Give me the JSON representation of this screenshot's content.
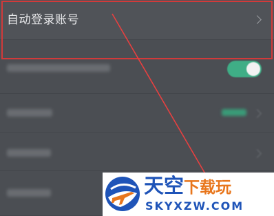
{
  "settings": {
    "rows": [
      {
        "label": "自动登录账号",
        "type": "link"
      }
    ]
  },
  "overlay": {
    "highlight_color": "#d23a3a",
    "arrow_color": "#e84040"
  },
  "watermark": {
    "name_main": "天空",
    "name_accent": "下载玩",
    "url": "SKYXZW.COM",
    "logo_icon": "airplane-logo-icon",
    "brand_color": "#1f54b8",
    "accent_color": "#e8761c"
  },
  "colors": {
    "background": "#4b4e53",
    "toggle_on": "#3fae86"
  }
}
